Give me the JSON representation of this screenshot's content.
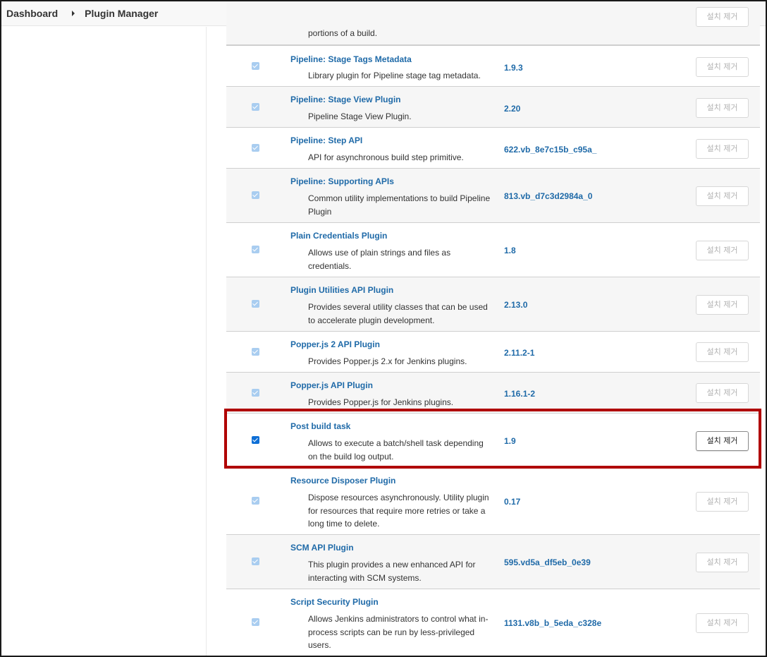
{
  "breadcrumb": {
    "home": "Dashboard",
    "current": "Plugin Manager"
  },
  "uninstall_label": "설치 제거",
  "highlight_color": "#b00000",
  "plugins": [
    {
      "name": "",
      "description": "portions of a build.",
      "version": ""
    },
    {
      "name": "Pipeline: Stage Tags Metadata",
      "description": "Library plugin for Pipeline stage tag metadata.",
      "version": "1.9.3"
    },
    {
      "name": "Pipeline: Stage View Plugin",
      "description": "Pipeline Stage View Plugin.",
      "version": "2.20"
    },
    {
      "name": "Pipeline: Step API",
      "description": "API for asynchronous build step primitive.",
      "version": "622.vb_8e7c15b_c95a_"
    },
    {
      "name": "Pipeline: Supporting APIs",
      "description": "Common utility implementations to build Pipeline Plugin",
      "version": "813.vb_d7c3d2984a_0"
    },
    {
      "name": "Plain Credentials Plugin",
      "description": "Allows use of plain strings and files as credentials.",
      "version": "1.8"
    },
    {
      "name": "Plugin Utilities API Plugin",
      "description": "Provides several utility classes that can be used to accelerate plugin development.",
      "version": "2.13.0"
    },
    {
      "name": "Popper.js 2 API Plugin",
      "description": "Provides Popper.js 2.x for Jenkins plugins.",
      "version": "2.11.2-1"
    },
    {
      "name": "Popper.js API Plugin",
      "description": "Provides Popper.js for Jenkins plugins.",
      "version": "1.16.1-2"
    },
    {
      "name": "Post build task",
      "description": "Allows to execute a batch/shell task depending on the build log output.",
      "version": "1.9"
    },
    {
      "name": "Resource Disposer Plugin",
      "description": "Dispose resources asynchronously. Utility plugin for resources that require more retries or take a long time to delete.",
      "version": "0.17"
    },
    {
      "name": "SCM API Plugin",
      "description": "This plugin provides a new enhanced API for interacting with SCM systems.",
      "version": "595.vd5a_df5eb_0e39"
    },
    {
      "name": "Script Security Plugin",
      "description": "Allows Jenkins administrators to control what in-process scripts can be run by less-privileged users.",
      "version": "1131.v8b_b_5eda_c328e"
    }
  ]
}
